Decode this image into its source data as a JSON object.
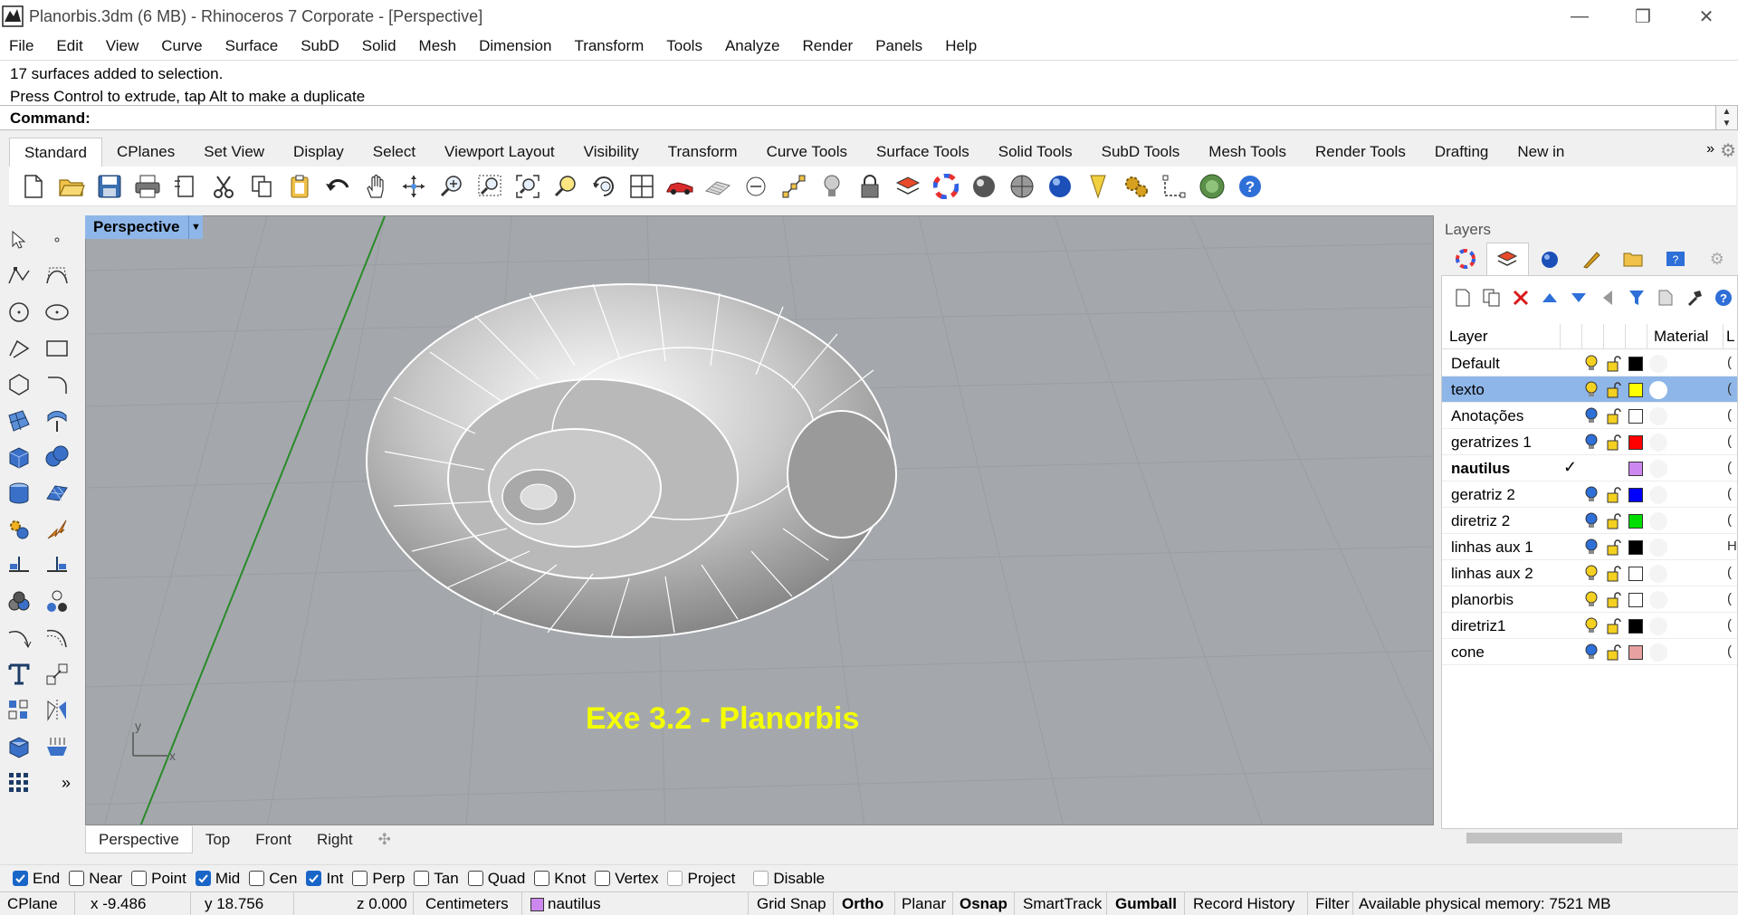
{
  "window": {
    "title": "Planorbis.3dm (6 MB) - Rhinoceros 7 Corporate - [Perspective]",
    "minimize": "—",
    "restore": "❐",
    "close": "✕"
  },
  "menu": [
    "File",
    "Edit",
    "View",
    "Curve",
    "Surface",
    "SubD",
    "Solid",
    "Mesh",
    "Dimension",
    "Transform",
    "Tools",
    "Analyze",
    "Render",
    "Panels",
    "Help"
  ],
  "command": {
    "history": [
      "17 surfaces added to selection.",
      "Press Control to extrude, tap Alt to make a duplicate"
    ],
    "prompt": "Command:"
  },
  "toolbar_tabs": {
    "items": [
      "Standard",
      "CPlanes",
      "Set View",
      "Display",
      "Select",
      "Viewport Layout",
      "Visibility",
      "Transform",
      "Curve Tools",
      "Surface Tools",
      "Solid Tools",
      "SubD Tools",
      "Mesh Tools",
      "Render Tools",
      "Drafting",
      "New in"
    ],
    "more": "»",
    "active": "Standard"
  },
  "viewport": {
    "title": "Perspective",
    "dropdown": "▼",
    "caption": "Exe 3.2 - Planorbis",
    "axis_y": "y",
    "axis_x": "x"
  },
  "viewport_tabs": {
    "items": [
      "Perspective",
      "Top",
      "Front",
      "Right"
    ],
    "add": "✣"
  },
  "layers_panel": {
    "title": "Layers",
    "col_layer": "Layer",
    "col_material": "Material",
    "col_tail": "L",
    "layers": [
      {
        "name": "Default",
        "color": "#000000",
        "bulb": "on",
        "tail": "("
      },
      {
        "name": "texto",
        "color": "#ffff00",
        "bulb": "on",
        "tail": "(",
        "selected": true
      },
      {
        "name": "Anotações",
        "color": "#ffffff",
        "bulb": "off",
        "tail": "("
      },
      {
        "name": "geratrizes 1",
        "color": "#ff0000",
        "bulb": "off",
        "tail": "("
      },
      {
        "name": "nautilus",
        "color": "#cc88ee",
        "bulb": "current",
        "tail": "(",
        "current": true,
        "check": "✓"
      },
      {
        "name": "geratriz 2",
        "color": "#0000ff",
        "bulb": "off",
        "tail": "("
      },
      {
        "name": "diretriz 2",
        "color": "#00dd00",
        "bulb": "off",
        "tail": "("
      },
      {
        "name": "linhas aux 1",
        "color": "#000000",
        "bulb": "off",
        "tail": "H"
      },
      {
        "name": "linhas aux 2",
        "color": "#ffffff",
        "bulb": "on",
        "tail": "("
      },
      {
        "name": "planorbis",
        "color": "#ffffff",
        "bulb": "on",
        "tail": "("
      },
      {
        "name": "diretriz1",
        "color": "#000000",
        "bulb": "on",
        "tail": "("
      },
      {
        "name": "cone",
        "color": "#e8a0a0",
        "bulb": "off",
        "tail": "("
      }
    ]
  },
  "osnaps": [
    {
      "label": "End",
      "checked": true
    },
    {
      "label": "Near",
      "checked": false
    },
    {
      "label": "Point",
      "checked": false
    },
    {
      "label": "Mid",
      "checked": true
    },
    {
      "label": "Cen",
      "checked": false
    },
    {
      "label": "Int",
      "checked": true
    },
    {
      "label": "Perp",
      "checked": false
    },
    {
      "label": "Tan",
      "checked": false
    },
    {
      "label": "Quad",
      "checked": false
    },
    {
      "label": "Knot",
      "checked": false
    },
    {
      "label": "Vertex",
      "checked": false
    },
    {
      "label": "Project",
      "checked": false
    },
    {
      "label": "Disable",
      "checked": false
    }
  ],
  "status": {
    "cplane": "CPlane",
    "x": "x -9.486",
    "y": "y 18.756",
    "z": "z 0.000",
    "units": "Centimeters",
    "layer": "nautilus",
    "layer_color": "#cc88ee",
    "grid_snap": "Grid Snap",
    "ortho": "Ortho",
    "planar": "Planar",
    "osnap": "Osnap",
    "smarttrack": "SmartTrack",
    "gumball": "Gumball",
    "record_history": "Record History",
    "filter": "Filter",
    "memory": "Available physical memory: 7521 MB"
  },
  "colors": {
    "viewport_bg": "#a4a8ad",
    "selection_blue": "#8fb6e8",
    "caption_yellow": "#f4ff00"
  }
}
